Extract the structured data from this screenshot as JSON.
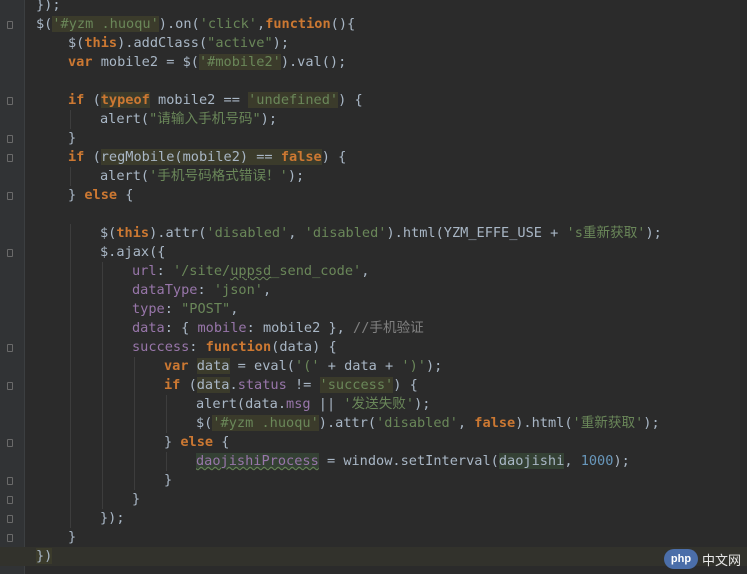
{
  "editor": {
    "lines": [
      {
        "indent": 0,
        "tokens": [
          {
            "t": "});",
            "c": ""
          }
        ]
      },
      {
        "indent": 0,
        "tokens": [
          {
            "t": "$(",
            "c": ""
          },
          {
            "t": "'#yzm .huoqu'",
            "c": "str hl"
          },
          {
            "t": ").on(",
            "c": ""
          },
          {
            "t": "'click'",
            "c": "str"
          },
          {
            "t": ",",
            "c": ""
          },
          {
            "t": "function",
            "c": "kw"
          },
          {
            "t": "(){",
            "c": ""
          }
        ]
      },
      {
        "indent": 1,
        "tokens": [
          {
            "t": "$(",
            "c": ""
          },
          {
            "t": "this",
            "c": "kw"
          },
          {
            "t": ").addClass(",
            "c": ""
          },
          {
            "t": "\"active\"",
            "c": "str"
          },
          {
            "t": ");",
            "c": ""
          }
        ]
      },
      {
        "indent": 1,
        "tokens": [
          {
            "t": "var ",
            "c": "kw"
          },
          {
            "t": "mobile2 = $(",
            "c": ""
          },
          {
            "t": "'#mobile2'",
            "c": "str hl"
          },
          {
            "t": ").val();",
            "c": ""
          }
        ]
      },
      {
        "indent": 0,
        "tokens": []
      },
      {
        "indent": 1,
        "tokens": [
          {
            "t": "if ",
            "c": "kw"
          },
          {
            "t": "(",
            "c": ""
          },
          {
            "t": "typeof",
            "c": "kw hl"
          },
          {
            "t": " mobile2 == ",
            "c": ""
          },
          {
            "t": "'undefined'",
            "c": "str hl"
          },
          {
            "t": ") {",
            "c": ""
          }
        ]
      },
      {
        "indent": 2,
        "tokens": [
          {
            "t": "alert(",
            "c": ""
          },
          {
            "t": "\"请输入手机号码\"",
            "c": "str"
          },
          {
            "t": ");",
            "c": ""
          }
        ]
      },
      {
        "indent": 1,
        "tokens": [
          {
            "t": "}",
            "c": ""
          }
        ]
      },
      {
        "indent": 1,
        "tokens": [
          {
            "t": "if ",
            "c": "kw"
          },
          {
            "t": "(",
            "c": ""
          },
          {
            "t": "regMobile(mobile2) == ",
            "c": "hl"
          },
          {
            "t": "false",
            "c": "kw hl"
          },
          {
            "t": ") {",
            "c": ""
          }
        ]
      },
      {
        "indent": 2,
        "tokens": [
          {
            "t": "alert(",
            "c": ""
          },
          {
            "t": "'手机号码格式错误！'",
            "c": "str"
          },
          {
            "t": ");",
            "c": ""
          }
        ]
      },
      {
        "indent": 1,
        "tokens": [
          {
            "t": "} ",
            "c": ""
          },
          {
            "t": "else",
            "c": "kw"
          },
          {
            "t": " {",
            "c": ""
          }
        ]
      },
      {
        "indent": 0,
        "tokens": []
      },
      {
        "indent": 2,
        "tokens": [
          {
            "t": "$(",
            "c": ""
          },
          {
            "t": "this",
            "c": "kw"
          },
          {
            "t": ").attr(",
            "c": ""
          },
          {
            "t": "'disabled'",
            "c": "str"
          },
          {
            "t": ", ",
            "c": ""
          },
          {
            "t": "'disabled'",
            "c": "str"
          },
          {
            "t": ").html(YZM_EFFE_USE + ",
            "c": ""
          },
          {
            "t": "'s重新获取'",
            "c": "str"
          },
          {
            "t": ");",
            "c": ""
          }
        ]
      },
      {
        "indent": 2,
        "tokens": [
          {
            "t": "$.ajax({",
            "c": ""
          }
        ]
      },
      {
        "indent": 3,
        "tokens": [
          {
            "t": "url",
            "c": "prop"
          },
          {
            "t": ": ",
            "c": ""
          },
          {
            "t": "'/site/",
            "c": "str"
          },
          {
            "t": "uppsd",
            "c": "str squig"
          },
          {
            "t": "_send_code'",
            "c": "str"
          },
          {
            "t": ",",
            "c": ""
          }
        ]
      },
      {
        "indent": 3,
        "tokens": [
          {
            "t": "dataType",
            "c": "prop"
          },
          {
            "t": ": ",
            "c": ""
          },
          {
            "t": "'json'",
            "c": "str"
          },
          {
            "t": ",",
            "c": ""
          }
        ]
      },
      {
        "indent": 3,
        "tokens": [
          {
            "t": "type",
            "c": "prop"
          },
          {
            "t": ": ",
            "c": ""
          },
          {
            "t": "\"POST\"",
            "c": "str"
          },
          {
            "t": ",",
            "c": ""
          }
        ]
      },
      {
        "indent": 3,
        "tokens": [
          {
            "t": "data",
            "c": "prop"
          },
          {
            "t": ": { ",
            "c": ""
          },
          {
            "t": "mobile",
            "c": "prop"
          },
          {
            "t": ": mobile2 }, ",
            "c": ""
          },
          {
            "t": "//手机验证",
            "c": "cmt"
          }
        ]
      },
      {
        "indent": 3,
        "tokens": [
          {
            "t": "success",
            "c": "prop"
          },
          {
            "t": ": ",
            "c": ""
          },
          {
            "t": "function",
            "c": "kw"
          },
          {
            "t": "(data) {",
            "c": ""
          }
        ]
      },
      {
        "indent": 4,
        "tokens": [
          {
            "t": "var ",
            "c": "kw"
          },
          {
            "t": "data",
            "c": "hl"
          },
          {
            "t": " = eval(",
            "c": ""
          },
          {
            "t": "'('",
            "c": "str"
          },
          {
            "t": " + data + ",
            "c": ""
          },
          {
            "t": "')'",
            "c": "str"
          },
          {
            "t": ");",
            "c": ""
          }
        ]
      },
      {
        "indent": 4,
        "tokens": [
          {
            "t": "if ",
            "c": "kw"
          },
          {
            "t": "(",
            "c": ""
          },
          {
            "t": "data",
            "c": "hl"
          },
          {
            "t": ".",
            "c": ""
          },
          {
            "t": "status",
            "c": "prop"
          },
          {
            "t": " != ",
            "c": ""
          },
          {
            "t": "'success'",
            "c": "str hl"
          },
          {
            "t": ") {",
            "c": ""
          }
        ]
      },
      {
        "indent": 5,
        "tokens": [
          {
            "t": "alert(data.",
            "c": ""
          },
          {
            "t": "msg",
            "c": "prop"
          },
          {
            "t": " || ",
            "c": ""
          },
          {
            "t": "'发送失败'",
            "c": "str"
          },
          {
            "t": ");",
            "c": ""
          }
        ]
      },
      {
        "indent": 5,
        "tokens": [
          {
            "t": "$(",
            "c": ""
          },
          {
            "t": "'#yzm .huoqu'",
            "c": "str hl"
          },
          {
            "t": ").attr(",
            "c": ""
          },
          {
            "t": "'disabled'",
            "c": "str"
          },
          {
            "t": ", ",
            "c": ""
          },
          {
            "t": "false",
            "c": "kw"
          },
          {
            "t": ").html(",
            "c": ""
          },
          {
            "t": "'重新获取'",
            "c": "str"
          },
          {
            "t": ");",
            "c": ""
          }
        ]
      },
      {
        "indent": 4,
        "tokens": [
          {
            "t": "} ",
            "c": ""
          },
          {
            "t": "else",
            "c": "kw"
          },
          {
            "t": " {",
            "c": ""
          }
        ]
      },
      {
        "indent": 5,
        "tokens": [
          {
            "t": "daojishiProcess",
            "c": "prop hl2 squig"
          },
          {
            "t": " = window.setInterval(",
            "c": ""
          },
          {
            "t": "daojishi",
            "c": "hl2"
          },
          {
            "t": ", ",
            "c": ""
          },
          {
            "t": "1000",
            "c": "num"
          },
          {
            "t": ");",
            "c": ""
          }
        ]
      },
      {
        "indent": 4,
        "tokens": [
          {
            "t": "}",
            "c": ""
          }
        ]
      },
      {
        "indent": 3,
        "tokens": [
          {
            "t": "}",
            "c": ""
          }
        ]
      },
      {
        "indent": 2,
        "tokens": [
          {
            "t": "});",
            "c": ""
          }
        ]
      },
      {
        "indent": 1,
        "tokens": [
          {
            "t": "}",
            "c": ""
          }
        ]
      },
      {
        "indent": 0,
        "current": true,
        "tokens": [
          {
            "t": "})",
            "c": "hl"
          }
        ]
      }
    ]
  },
  "watermark": {
    "logo_text": "php",
    "site_text": "中文网"
  }
}
